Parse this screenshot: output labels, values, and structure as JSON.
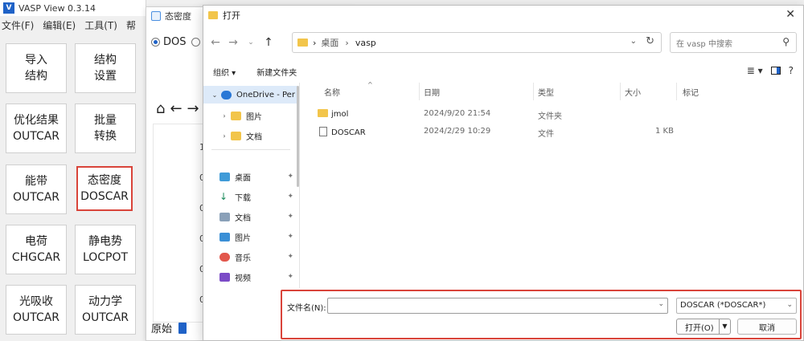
{
  "vasp": {
    "title": "VASP View 0.3.14",
    "logo_text": "V",
    "menu": [
      "文件(F)",
      "编辑(E)",
      "工具(T)",
      "帮"
    ],
    "buttons": [
      {
        "line1": "导入",
        "line2": "结构"
      },
      {
        "line1": "结构",
        "line2": "设置"
      },
      {
        "line1": "优化结果",
        "line2": "OUTCAR"
      },
      {
        "line1": "批量",
        "line2": "转换"
      },
      {
        "line1": "能带",
        "line2": "OUTCAR"
      },
      {
        "line1": "态密度",
        "line2": "DOSCAR"
      },
      {
        "line1": "电荷",
        "line2": "CHGCAR"
      },
      {
        "line1": "静电势",
        "line2": "LOCPOT"
      },
      {
        "line1": "光吸收",
        "line2": "OUTCAR"
      },
      {
        "line1": "动力学",
        "line2": "OUTCAR"
      }
    ]
  },
  "dos_window": {
    "title": "态密度",
    "radio_label": "DOS",
    "ticks": [
      "1",
      "0",
      "0",
      "0",
      "0",
      "0"
    ],
    "bottom_label": "原始"
  },
  "dialog": {
    "title": "打开",
    "breadcrumb": [
      "桌面",
      "vasp"
    ],
    "search_placeholder": "在 vasp 中搜索",
    "organize": "组织 ▾",
    "new_folder": "新建文件夹",
    "nav": {
      "onedrive": "OneDrive - Per",
      "quick": [
        "图片",
        "文档"
      ],
      "pinned": [
        "桌面",
        "下载",
        "文档",
        "图片",
        "音乐",
        "视频"
      ]
    },
    "columns": {
      "name": "名称",
      "date": "日期",
      "type": "类型",
      "size": "大小",
      "tags": "标记"
    },
    "files": [
      {
        "name": "jmol",
        "date": "2024/9/20 21:54",
        "type": "文件夹",
        "size": ""
      },
      {
        "name": "DOSCAR",
        "date": "2024/2/29 10:29",
        "type": "文件",
        "size": "1 KB"
      }
    ],
    "filename_label": "文件名(N):",
    "filename_value": "",
    "filetype": "DOSCAR (*DOSCAR*)",
    "open_label": "打开(O)",
    "cancel_label": "取消"
  },
  "colors": {
    "accent": "#1f62c7",
    "highlight": "#d9443a",
    "folder": "#f2c54b"
  }
}
